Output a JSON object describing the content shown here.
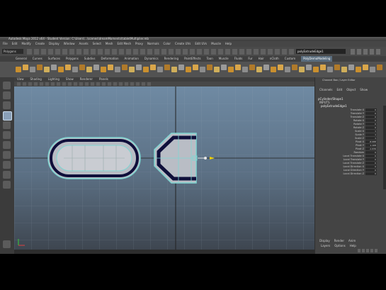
{
  "window": {
    "title": "Autodesk Maya 2012 x64 - Student Version: C:\\Users\\...\\scenes\\dreamMoments\\tabletMultiplier.mb"
  },
  "menubar": [
    "File",
    "Edit",
    "Modify",
    "Create",
    "Display",
    "Window",
    "Assets",
    "Select",
    "Mesh",
    "Edit Mesh",
    "Proxy",
    "Normals",
    "Color",
    "Create UVs",
    "Edit UVs",
    "Muscle",
    "Help"
  ],
  "statusline": {
    "mode": "Polygons",
    "search_value": "polyExtrudeEdge1"
  },
  "shelf": {
    "tabs": [
      "General",
      "Curves",
      "Surfaces",
      "Polygons",
      "Subdivs",
      "Deformation",
      "Animation",
      "Dynamics",
      "Rendering",
      "PaintEffects",
      "Toon",
      "Muscle",
      "Fluids",
      "Fur",
      "Hair",
      "nCloth",
      "Custom",
      "PolyDemoModeling"
    ],
    "active_tab": "PolyDemoModeling"
  },
  "panel": {
    "menus": [
      "View",
      "Shading",
      "Lighting",
      "Show",
      "Renderer",
      "Panels"
    ]
  },
  "channel_box": {
    "title": "Channel Box / Layer Editor",
    "tabs": [
      "Channels",
      "Edit",
      "Object",
      "Show"
    ],
    "object_name": "pCylinder/Shape1",
    "inputs_header": "INPUTS",
    "node": "polyExtrudeEdge1",
    "attributes": [
      {
        "label": "Translate X",
        "value": "0"
      },
      {
        "label": "Translate Y",
        "value": "0"
      },
      {
        "label": "Translate Z",
        "value": "0"
      },
      {
        "label": "Rotate X",
        "value": "0"
      },
      {
        "label": "Rotate Y",
        "value": "0"
      },
      {
        "label": "Rotate Z",
        "value": "0"
      },
      {
        "label": "Scale X",
        "value": "1"
      },
      {
        "label": "Scale Y",
        "value": "1"
      },
      {
        "label": "Scale Z",
        "value": "1"
      },
      {
        "label": "Pivot X",
        "value": "-8.088"
      },
      {
        "label": "Pivot Y",
        "value": "1.108"
      },
      {
        "label": "Pivot Z",
        "value": "-1.039"
      },
      {
        "label": "Random",
        "value": "0"
      },
      {
        "label": "Local Translate X",
        "value": "0"
      },
      {
        "label": "Local Translate Y",
        "value": "0"
      },
      {
        "label": "Local Translate Z",
        "value": "0"
      },
      {
        "label": "Local Direction X",
        "value": "0"
      },
      {
        "label": "Local Direction Y",
        "value": "0"
      },
      {
        "label": "Local Direction Z",
        "value": "0"
      }
    ],
    "layer_tabs": [
      "Display",
      "Render",
      "Anim"
    ],
    "layer_menus": [
      "Layers",
      "Options",
      "Help"
    ]
  },
  "colors": {
    "accent": "#5a6d7e",
    "selection": "#7fd6d2",
    "mesh_dark": "#0f0f3a",
    "viewport_top": "#6f8aa3",
    "viewport_bottom": "#3e4650"
  }
}
